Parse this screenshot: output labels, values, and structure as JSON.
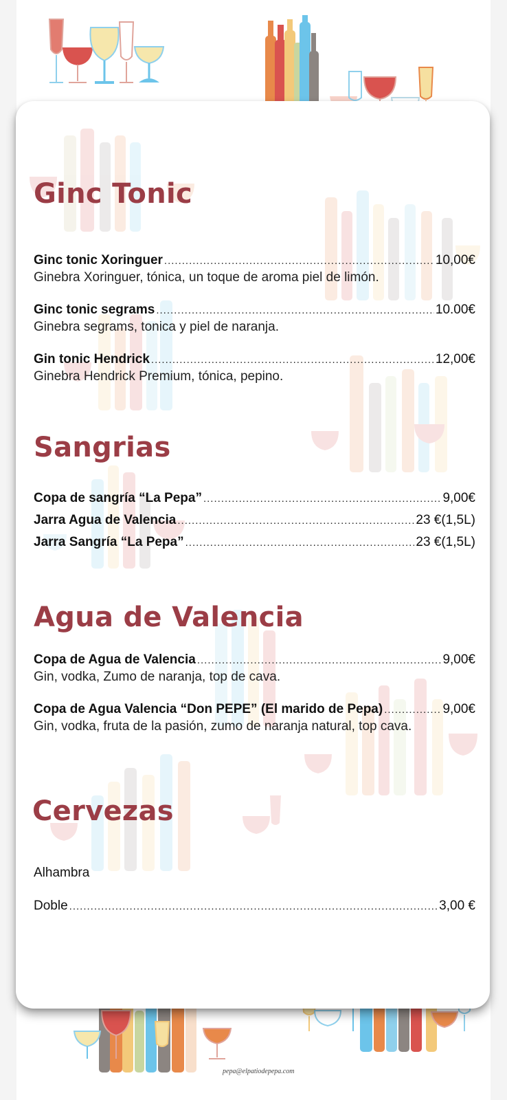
{
  "sections": [
    {
      "title": "Ginc Tonic",
      "items": [
        {
          "name": "Ginc tonic Xoringuer",
          "price": "10,00€",
          "desc": "Ginebra Xoringuer, tónica, un toque de aroma piel de limón."
        },
        {
          "name": "Ginc tonic segrams",
          "price": "10.00€",
          "desc": "Ginebra segrams, tonica y piel de naranja."
        },
        {
          "name": "Gin tonic Hendrick",
          "price": "12,00€",
          "desc": "Ginebra Hendrick Premium, tónica, pepino."
        }
      ]
    },
    {
      "title": "Sangrias",
      "items": [
        {
          "name": "Copa de sangría “La Pepa”",
          "price": "9,00€"
        },
        {
          "name": "Jarra Agua de Valencia",
          "price": "23 €(1,5L)"
        },
        {
          "name": "Jarra Sangría “La Pepa”",
          "price": "23 €(1,5L)"
        }
      ]
    },
    {
      "title": "Agua de Valencia",
      "items": [
        {
          "name": "Copa de Agua de Valencia",
          "price": "9,00€",
          "desc": "Gin, vodka, Zumo de naranja, top de cava."
        },
        {
          "name": "Copa de Agua Valencia “Don PEPE” (El marido de Pepa)",
          "price": "9,00€",
          "desc": "Gin, vodka, fruta de la pasión, zumo de naranja natural, top cava."
        }
      ]
    },
    {
      "title": "Cervezas",
      "subheading": "Alhambra",
      "items": [
        {
          "name": "Doble",
          "price": "3,00 €"
        }
      ]
    }
  ],
  "footer": {
    "email": "pepa@elpatiodepepa.com"
  },
  "colors": {
    "accent": "#9b3d46",
    "glass_red": "#d9534f",
    "glass_yellow": "#f3dc8c",
    "glass_blue": "#6cc4ea",
    "bottle_orange": "#e8894a",
    "bottle_grey": "#8c8581"
  }
}
